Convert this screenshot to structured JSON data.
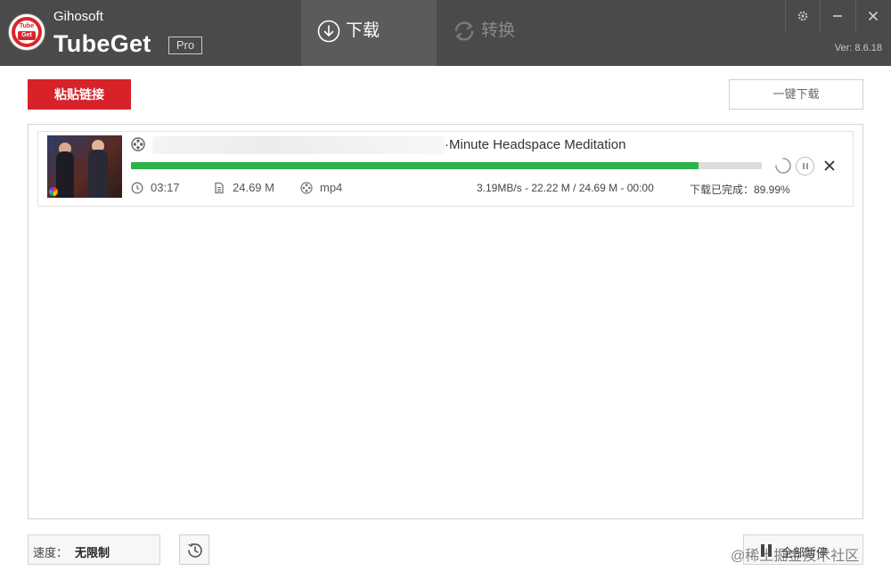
{
  "app": {
    "company": "Gihosoft",
    "name": "TubeGet",
    "edition": "Pro",
    "logo_text_top": "Tube",
    "logo_text_bottom": "Get",
    "version": "Ver: 8.6.18"
  },
  "tabs": [
    {
      "label": "下载",
      "icon": "download-circle-icon",
      "active": true
    },
    {
      "label": "转换",
      "icon": "convert-cycle-icon",
      "active": false
    }
  ],
  "window_controls": {
    "settings": "gear-icon",
    "minimize": "minimize-icon",
    "close": "close-icon"
  },
  "toolbar": {
    "paste_label": "粘贴链接",
    "onekey_label": "一键下载"
  },
  "downloads": [
    {
      "title": "·Minute Headspace Meditation",
      "progress_percent": 89.99,
      "duration": "03:17",
      "size": "24.69 M",
      "format": "mp4",
      "speed_info": "3.19MB/s - 22.22 M / 24.69 M - 00:00",
      "status": "下载已完成：89.99%"
    }
  ],
  "footer": {
    "speed_label": "速度：",
    "speed_value": "无限制",
    "sort_label": "全部暂停",
    "watermark": "@稀土掘金技术社区"
  },
  "colors": {
    "titlebar": "#4a4a4a",
    "accent_red": "#d62228",
    "progress_green": "#2eb24a"
  }
}
